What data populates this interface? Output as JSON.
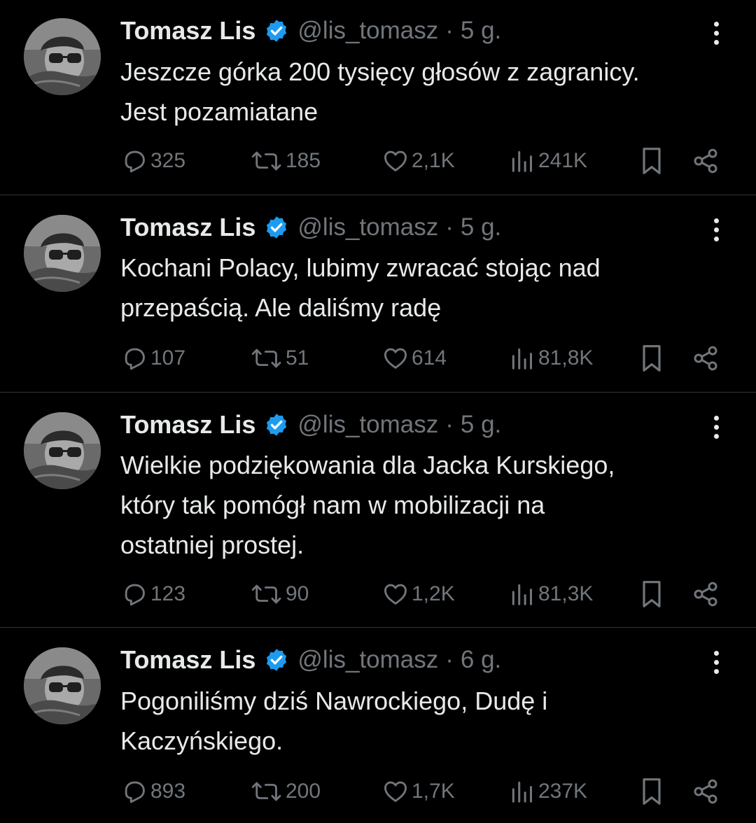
{
  "colors": {
    "background": "#000000",
    "text": "#e7e9ea",
    "muted": "#71767b",
    "verified": "#1d9bf0",
    "divider": "#2f3336"
  },
  "tweets": [
    {
      "name": "Tomasz Lis",
      "handle": "@lis_tomasz",
      "dot": "·",
      "time": "5 g.",
      "lines": [
        "Jeszcze górka 200 tysięcy głosów z zagranicy.",
        "Jest pozamiatane"
      ],
      "replies": "325",
      "retweets": "185",
      "likes": "2,1K",
      "views": "241K"
    },
    {
      "name": "Tomasz Lis",
      "handle": "@lis_tomasz",
      "dot": "·",
      "time": "5 g.",
      "lines": [
        "Kochani Polacy, lubimy zwracać stojąc nad",
        "przepaścią. Ale daliśmy radę"
      ],
      "replies": "107",
      "retweets": "51",
      "likes": "614",
      "views": "81,8K"
    },
    {
      "name": "Tomasz Lis",
      "handle": "@lis_tomasz",
      "dot": "·",
      "time": "5 g.",
      "lines": [
        "Wielkie podziękowania dla Jacka Kurskiego,",
        "który tak pomógł nam w mobilizacji na",
        "ostatniej prostej."
      ],
      "replies": "123",
      "retweets": "90",
      "likes": "1,2K",
      "views": "81,3K"
    },
    {
      "name": "Tomasz Lis",
      "handle": "@lis_tomasz",
      "dot": "·",
      "time": "6 g.",
      "lines": [
        "Pogoniliśmy dziś Nawrockiego, Dudę i",
        "Kaczyńskiego."
      ],
      "replies": "893",
      "retweets": "200",
      "likes": "1,7K",
      "views": "237K"
    }
  ]
}
